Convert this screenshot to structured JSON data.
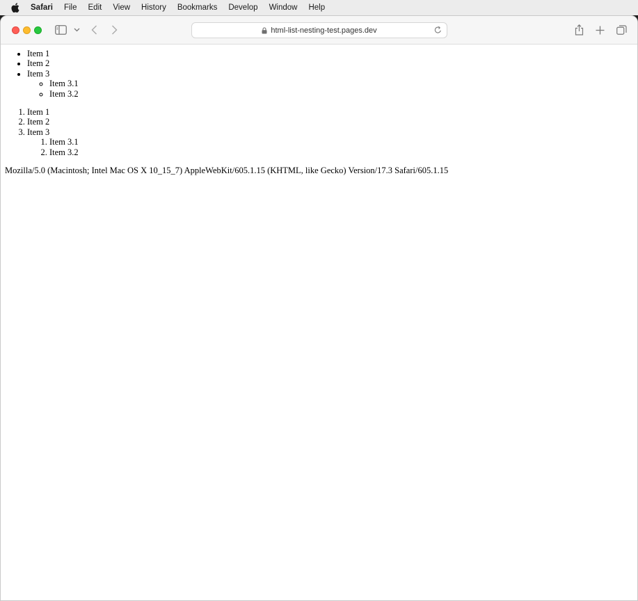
{
  "menubar": {
    "app_name": "Safari",
    "items": [
      "File",
      "Edit",
      "View",
      "History",
      "Bookmarks",
      "Develop",
      "Window",
      "Help"
    ]
  },
  "toolbar": {
    "address": "html-list-nesting-test.pages.dev"
  },
  "page": {
    "unordered_list": {
      "items": [
        "Item 1",
        "Item 2",
        "Item 3"
      ],
      "nested": [
        "Item 3.1",
        "Item 3.2"
      ]
    },
    "ordered_list": {
      "items": [
        "Item 1",
        "Item 2",
        "Item 3"
      ],
      "nested": [
        "Item 3.1",
        "Item 3.2"
      ]
    },
    "user_agent": "Mozilla/5.0 (Macintosh; Intel Mac OS X 10_15_7) AppleWebKit/605.1.15 (KHTML, like Gecko) Version/17.3 Safari/605.1.15"
  }
}
